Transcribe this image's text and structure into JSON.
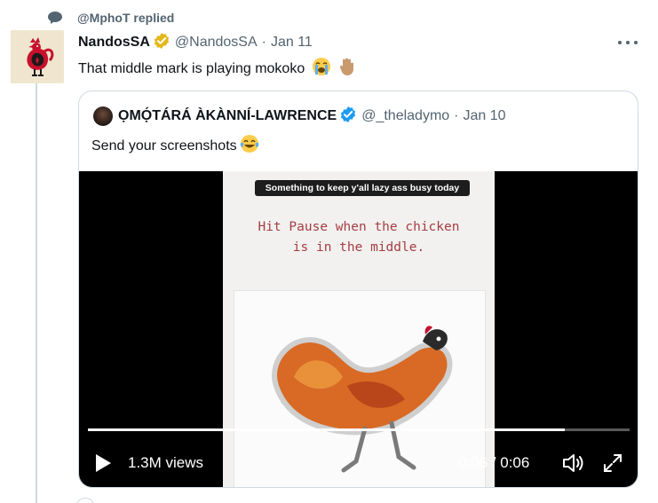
{
  "context": {
    "replied_text": "@MphoT replied"
  },
  "tweet": {
    "author_name": "NandosSA",
    "handle": "@NandosSA",
    "separator": "·",
    "date": "Jan 11",
    "text": "That middle mark is playing mokoko",
    "emojis": [
      "loudly-crying-face",
      "raised-hand-medium-skin-tone"
    ]
  },
  "quoted_tweet": {
    "author_name": "ỌMỌ́TÁRÁ ÀKÀNNÍ-LAWRENCE",
    "handle": "@_theladymo",
    "separator": "·",
    "date": "Jan 10",
    "text": "Send your screenshots",
    "emojis": [
      "face-with-tears-of-joy"
    ]
  },
  "video": {
    "banner_text": "Something to keep y'all lazy ass busy today",
    "instruction_line1": "Hit Pause when the chicken",
    "instruction_line2": "is in the middle.",
    "views": "1.3M views",
    "time": "0:06 / 0:06",
    "progress_fraction": 0.88
  },
  "colors": {
    "verified": "#1d9bf0",
    "verified_business": "#e2b719",
    "muted_text": "#536471",
    "border": "#cfd9de"
  }
}
